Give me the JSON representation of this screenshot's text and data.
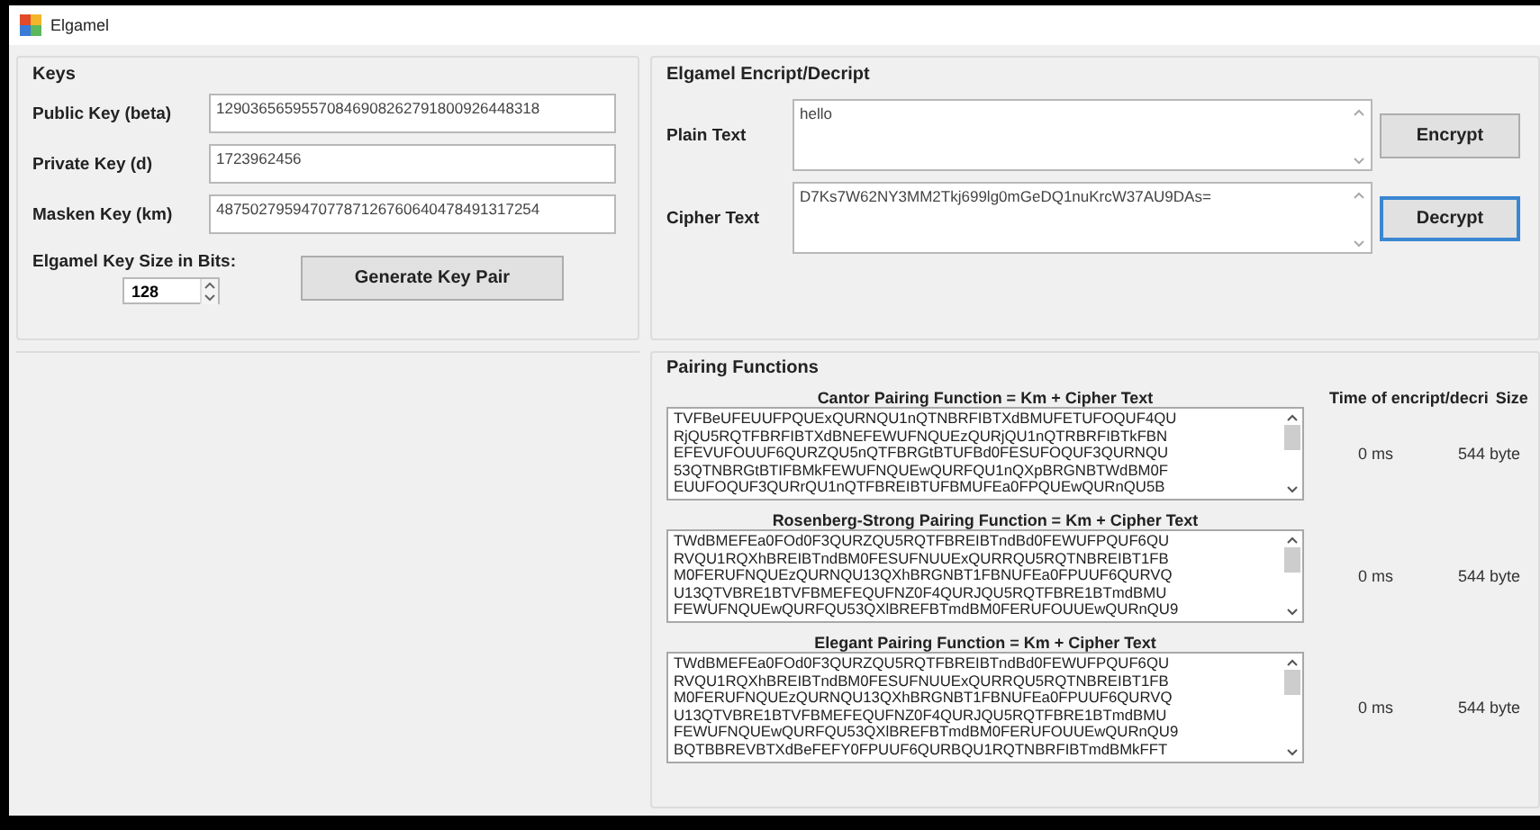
{
  "window": {
    "title": "Elgamel"
  },
  "keys": {
    "title": "Keys",
    "fields": [
      {
        "label": "Public Key (beta)",
        "value": "12903656595570846908262791800926448318"
      },
      {
        "label": "Private Key (d)",
        "value": "1723962456"
      },
      {
        "label": "Masken Key (km)",
        "value": "48750279594707787126760640478491317254"
      }
    ],
    "key_size_label": "Elgamel Key Size in Bits:",
    "key_size": "128",
    "generate_button": "Generate Key Pair"
  },
  "encrypt_decrypt": {
    "title": "Elgamel Encript/Decript",
    "rows": [
      {
        "label": "Plain Text",
        "value": "hello",
        "button": {
          "label": "Encrypt",
          "focused": false
        }
      },
      {
        "label": "Cipher Text",
        "value": "D7Ks7W62NY3MM2Tkj699lg0mGeDQ1nuKrcW37AU9DAs=",
        "button": {
          "label": "Decrypt",
          "focused": true
        }
      }
    ]
  },
  "pairing": {
    "title": "Pairing Functions",
    "columns": [
      "Time of encript/decri",
      "Size"
    ],
    "functions": [
      {
        "title": "Cantor Pairing Function = Km + Cipher Text",
        "time": "0 ms",
        "size": "544 byte",
        "lines": [
          "TVFBeUFEUUFPQUExQURNQU1nQTNBRFIBTXdBMUFETUFOQUF4QU",
          "RjQU5RQTFBRFIBTXdBNEFEWUFNQUEzQURjQU1nQTRBRFIBTkFBN",
          "EFEVUFOUUF6QURZQU5nQTFBRGtBTUFBd0FESUFOQUF3QURNQU",
          "53QTNBRGtBTIFBMkFEWUFNQUEwQURFQU1nQXpBRGNBTWdBM0F",
          "EUUFOQUF3QURrQU1nQTFBREIBTUFBMUFEa0FPQUEwQURnQU5B"
        ]
      },
      {
        "title": "Rosenberg-Strong Pairing Function = Km + Cipher Text",
        "time": "0 ms",
        "size": "544 byte",
        "lines": [
          "TWdBMEFEa0FOd0F3QURZQU5RQTFBREIBTndBd0FEWUFPQUF6QU",
          "RVQU1RQXhBREIBTndBM0FESUFNUUExQURRQU5RQTNBREIBT1FB",
          "M0FERUFNQUEzQURNQU13QXhBRGNBT1FBNUFEa0FPUUF6QURVQ",
          "U13QTVBRE1BTVFBMEFEQUFNZ0F4QURJQU5RQTFBRE1BTmdBMU",
          "FEWUFNQUEwQURFQU53QXlBREFBTmdBM0FERUFOUUEwQURnQU9"
        ]
      },
      {
        "title": "Elegant Pairing Function = Km + Cipher Text",
        "time": "0 ms",
        "size": "544 byte",
        "lines": [
          "TWdBMEFEa0FOd0F3QURZQU5RQTFBREIBTndBd0FEWUFPQUF6QU",
          "RVQU1RQXhBREIBTndBM0FESUFNUUExQURRQU5RQTNBREIBT1FB",
          "M0FERUFNQUEzQURNQU13QXhBRGNBT1FBNUFEa0FPUUF6QURVQ",
          "U13QTVBRE1BTVFBMEFEQUFNZ0F4QURJQU5RQTFBRE1BTmdBMU",
          "FEWUFNQUEwQURFQU53QXlBREFBTmdBM0FERUFOUUEwQURnQU9",
          "BQTBBREVBTXdBeFEFY0FPUUF6QURBQU1RQTNBRFIBTmdBMkFFT"
        ]
      }
    ]
  }
}
